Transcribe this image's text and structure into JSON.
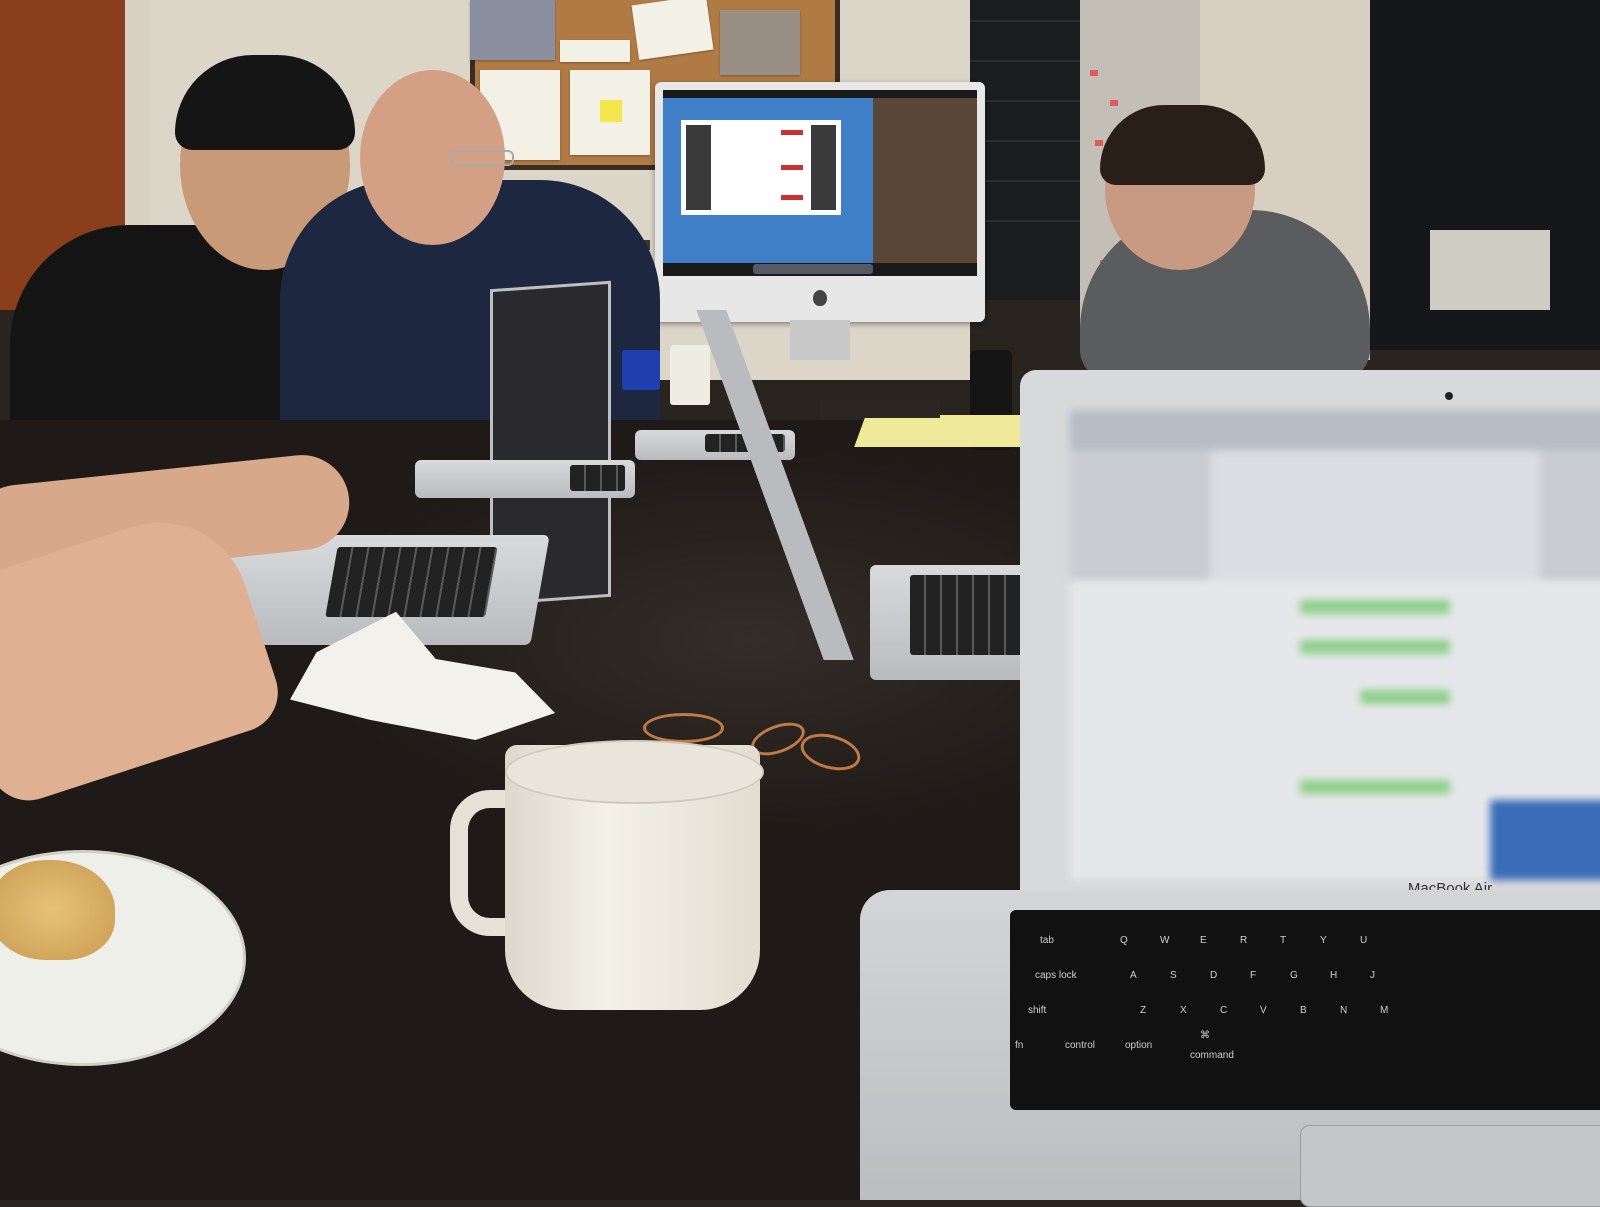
{
  "scene": {
    "laptop_brand_label": "MacBook Air",
    "keyboard_labels": {
      "tab": "tab",
      "caps": "caps lock",
      "shift": "shift",
      "fn": "fn",
      "control": "control",
      "option": "option",
      "command": "command",
      "command_symbol": "⌘",
      "letters_row1": [
        "Q",
        "W",
        "E",
        "R",
        "T",
        "Y",
        "U"
      ],
      "letters_row2": [
        "A",
        "S",
        "D",
        "F",
        "G",
        "H",
        "J"
      ],
      "letters_row3": [
        "Z",
        "X",
        "C",
        "V",
        "B",
        "N",
        "M"
      ]
    }
  },
  "colors": {
    "table": "#1f1a17",
    "wall": "#dcd6c8",
    "aluminum": "#d8d9db"
  }
}
